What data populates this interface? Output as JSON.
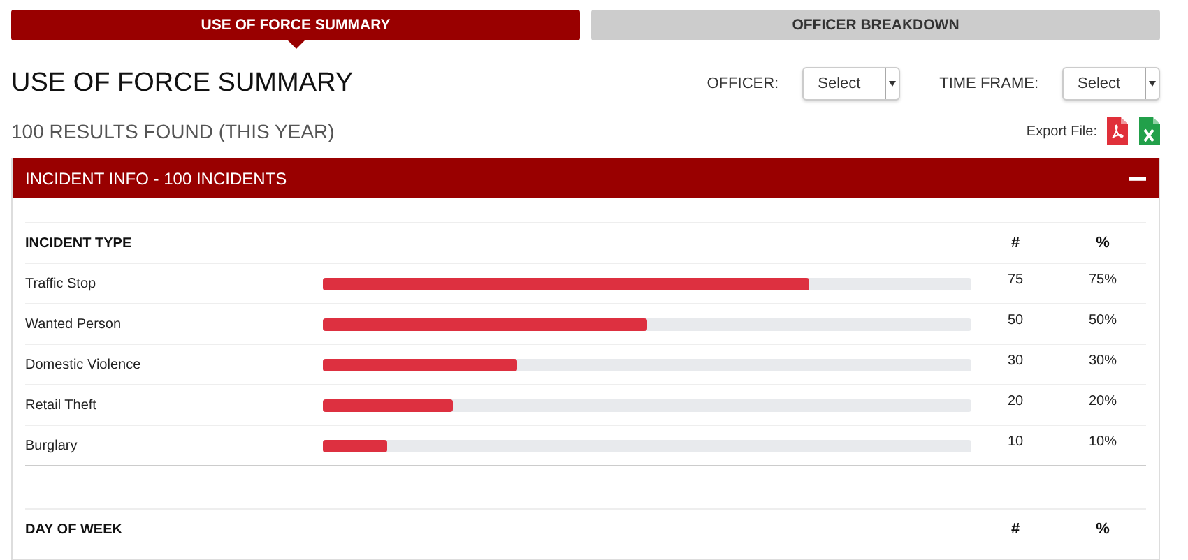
{
  "tabs": [
    {
      "label": "USE OF FORCE SUMMARY",
      "selected": true
    },
    {
      "label": "OFFICER BREAKDOWN",
      "selected": false
    }
  ],
  "title": "USE OF FORCE SUMMARY",
  "filters": [
    {
      "label": "OFFICER:",
      "value": "Select"
    },
    {
      "label": "TIME FRAME:",
      "value": "Select"
    }
  ],
  "results": "100 RESULTS FOUND (THIS YEAR)",
  "export": {
    "label": "Export File:"
  },
  "panel": {
    "title": "INCIDENT INFO - 100 INCIDENTS",
    "expanded": true,
    "sections": [
      {
        "heading": "INCIDENT TYPE",
        "count_header": "#",
        "percent_header": "%",
        "rows": [
          {
            "name": "Traffic Stop",
            "level": 0.75,
            "count": "75",
            "percent": "75%"
          },
          {
            "name": "Wanted Person",
            "level": 0.5,
            "count": "50",
            "percent": "50%"
          },
          {
            "name": "Domestic Violence",
            "level": 0.3,
            "count": "30",
            "percent": "30%"
          },
          {
            "name": "Retail Theft",
            "level": 0.2,
            "count": "20",
            "percent": "20%"
          },
          {
            "name": "Burglary",
            "level": 0.1,
            "count": "10",
            "percent": "10%"
          }
        ]
      },
      {
        "heading": "DAY OF WEEK",
        "count_header": "#",
        "percent_header": "%"
      }
    ]
  }
}
